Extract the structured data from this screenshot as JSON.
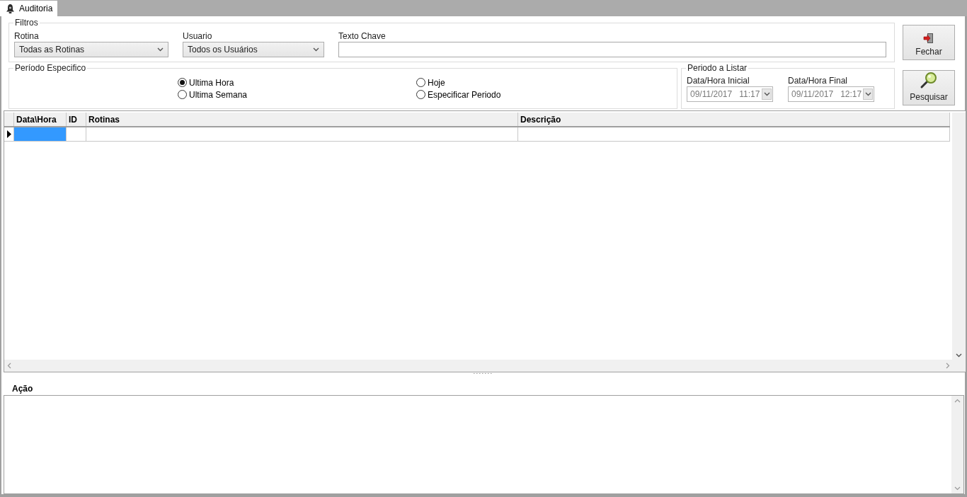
{
  "tab": {
    "label": "Auditoria",
    "selected": true
  },
  "filters": {
    "title": "Filtros",
    "rotina": {
      "label": "Rotina",
      "value": "Todas as Rotinas"
    },
    "usuario": {
      "label": "Usuario",
      "value": "Todos os Usuários"
    },
    "texto_chave": {
      "label": "Texto Chave"
    }
  },
  "periodo_especifico": {
    "title": "Período Especifico",
    "options": [
      {
        "label": "Ultima Hora",
        "selected": true
      },
      {
        "label": "Hoje",
        "selected": false
      },
      {
        "label": "Ultima Semana",
        "selected": false
      },
      {
        "label": "Especificar Periodo",
        "selected": false
      }
    ]
  },
  "periodo_listar": {
    "title": "Periodo a Listar",
    "fields": [
      {
        "label": "Data/Hora Inicial",
        "value": "09/11/2017   11:17",
        "disabled": true
      },
      {
        "label": "Data/Hora Final",
        "value": "09/11/2017   12:17",
        "disabled": true
      }
    ]
  },
  "buttons": [
    {
      "label": "Fechar",
      "kind": "close"
    },
    {
      "label": "Pesquisar",
      "kind": "search"
    }
  ],
  "grid": {
    "columns": [
      "Data\\Hora",
      "ID",
      "Rotinas",
      "Descrição"
    ],
    "rows": [
      {
        "current": true
      }
    ]
  },
  "action": {
    "label": "Ação"
  }
}
